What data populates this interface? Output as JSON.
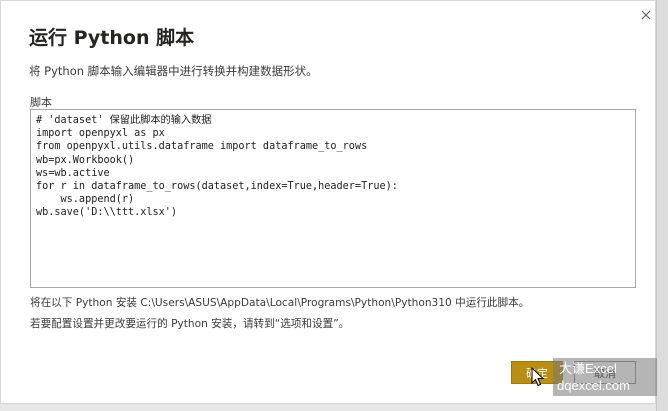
{
  "dialog": {
    "title": "运行 Python 脚本",
    "subtitle": "将 Python 脚本输入编辑器中进行转换并构建数据形状。",
    "script_label": "脚本",
    "script_lines": [
      "# 'dataset' 保留此脚本的输入数据",
      "import openpyxl as px",
      "from openpyxl.utils.dataframe import dataframe_to_rows",
      "wb=px.Workbook()",
      "ws=wb.active",
      "for r in dataframe_to_rows(dataset,index=True,header=True):",
      "    ws.append(r)",
      "wb.save('D:\\\\ttt.xlsx')"
    ],
    "install_info": "将在以下 Python 安装 C:\\Users\\ASUS\\AppData\\Local\\Programs\\Python\\Python310 中运行此脚本。",
    "settings_info": "若要配置设置并更改要运行的 Python 安装，请转到“选项和设置”。",
    "ok_label": "确定",
    "cancel_label": "取消",
    "close_icon": "close-icon"
  },
  "watermark": {
    "line1": "大谦Excel",
    "line2": "dqexcel.com"
  },
  "colors": {
    "ok_button": "#b88f11",
    "background": "#ffffff",
    "title_text": "#252423"
  }
}
